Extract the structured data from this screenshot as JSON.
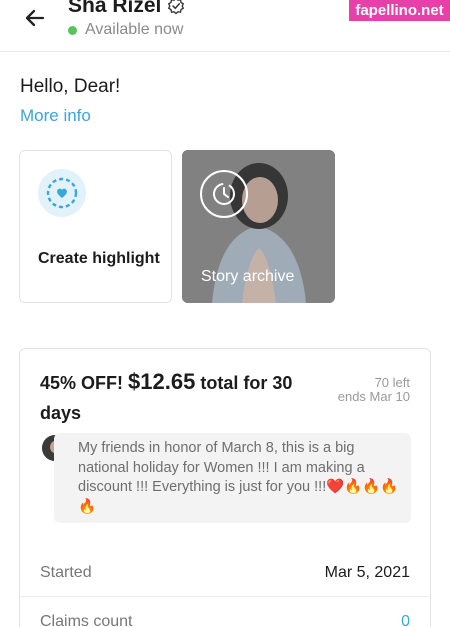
{
  "header": {
    "profile_name": "Sha Rizel",
    "status_text": "Available now",
    "watermark": "fapellino.net",
    "icons": {
      "back": "arrow-left-icon",
      "verified": "verified-check-icon",
      "settings": "gear-icon"
    },
    "status_color": "#5bc25b"
  },
  "intro": {
    "greeting": "Hello, Dear!",
    "more_info": "More info"
  },
  "highlights": {
    "create_label": "Create highlight",
    "archive_label": "Story archive"
  },
  "offer": {
    "discount": "45% OFF!",
    "price": "$12.65",
    "duration": "total for 30 days",
    "left_count": "70 left",
    "ends": "ends Mar 10",
    "message": "My friends in honor of March 8, this is a big national holiday for Women !!! I am making a discount !!! Everything is just for you !!!❤️🔥🔥🔥🔥",
    "rows": [
      {
        "label": "Started",
        "value": "Mar 5, 2021"
      },
      {
        "label": "Claims count",
        "value": "0"
      }
    ]
  },
  "colors": {
    "accent": "#3ba6d8",
    "watermark_bg": "#e83fa8"
  }
}
